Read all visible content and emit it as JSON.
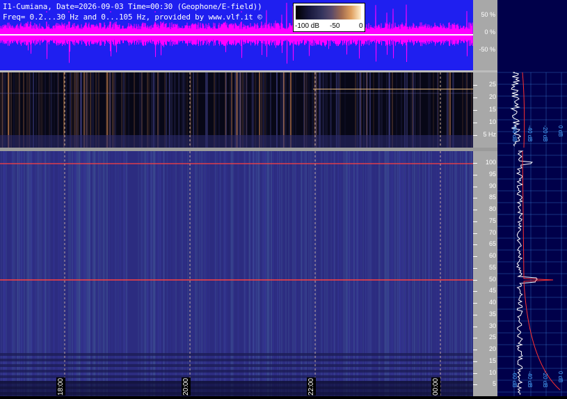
{
  "header": {
    "line1": "I1-Cumiana, Date=2026-09-03 Time=00:30 (Geophone/E-field))",
    "line2": "Freq= 0.2...30 Hz and 0...105 Hz, provided by www.vlf.it ©"
  },
  "color_scale": {
    "labels": [
      "-100 dB",
      "-50",
      "0"
    ]
  },
  "wave_scale": {
    "labels": [
      "50 %",
      "0 %",
      "-50 %"
    ]
  },
  "low_freq_scale": {
    "labels": [
      "25",
      "20",
      "15",
      "10",
      "5 Hz"
    ]
  },
  "high_freq_scale": {
    "labels": [
      "100",
      "95",
      "90",
      "85",
      "80",
      "75",
      "70",
      "65",
      "60",
      "55",
      "50",
      "45",
      "40",
      "35",
      "30",
      "25",
      "20",
      "15",
      "10",
      "5"
    ]
  },
  "time_labels": [
    "18:00",
    "20:00",
    "22:00",
    "00:00"
  ],
  "side_plot": {
    "top_labels": [
      "-60 dB",
      "-40 dB",
      "-20 dB",
      "0 dB"
    ],
    "bottom_labels": [
      "-60 dB",
      "-40 dB",
      "-20 dB",
      "0 dB"
    ]
  },
  "colors": {
    "wave_bg": "#1f1ff0",
    "wave_signal": "#ff00ff",
    "spec_bg": "#2c2c80",
    "marker_line": "#ff4040",
    "grid": "#4aa8ff"
  }
}
